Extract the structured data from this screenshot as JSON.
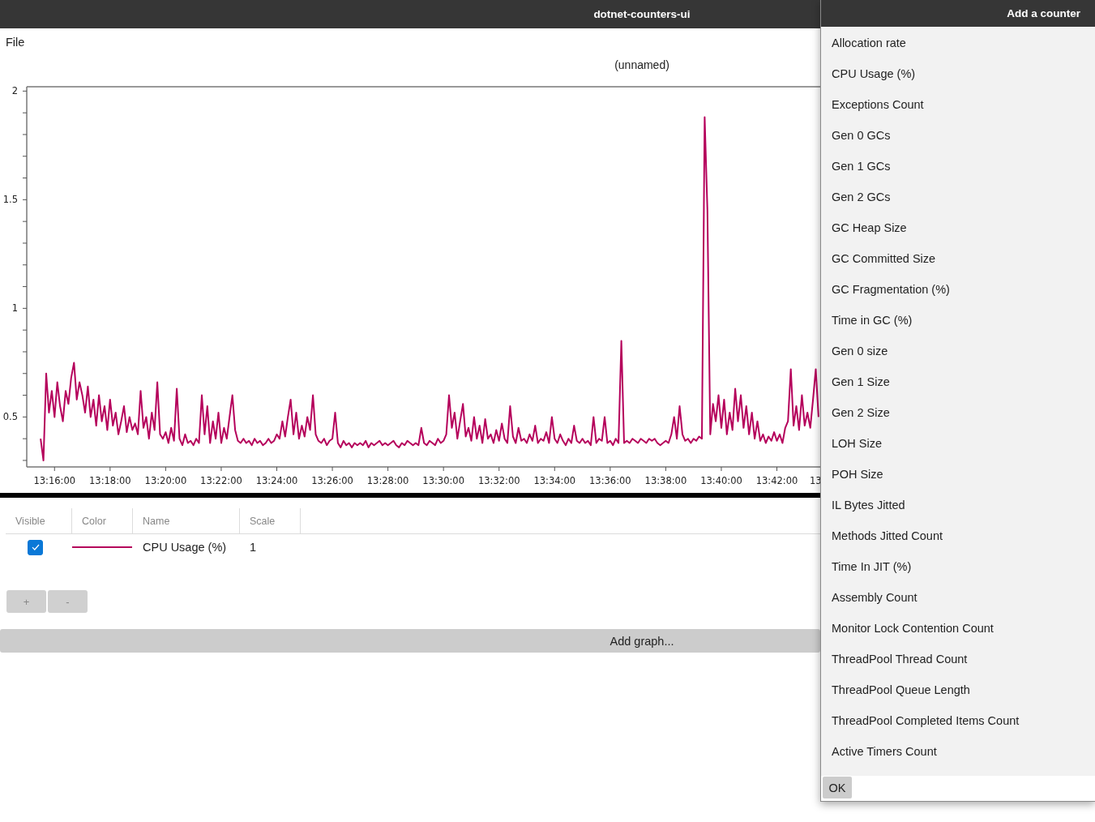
{
  "window": {
    "title": "dotnet-counters-ui"
  },
  "menu": [
    "File"
  ],
  "chart": {
    "chart_data": {
      "type": "line",
      "title": "(unnamed)",
      "ylim": [
        0.27,
        2.02
      ],
      "yticks": [
        0.5,
        1,
        1.5,
        2
      ],
      "categories": [
        null,
        null,
        null,
        null,
        null,
        "13:16:00",
        null,
        null,
        null,
        null,
        null,
        null,
        null,
        null,
        null,
        null,
        null,
        null,
        null,
        null,
        null,
        null,
        null,
        null,
        null,
        "13:18:00",
        null,
        null,
        null,
        null,
        null,
        null,
        null,
        null,
        null,
        null,
        null,
        null,
        null,
        null,
        null,
        null,
        null,
        null,
        null,
        "13:20:00",
        null,
        null,
        null,
        null,
        null,
        null,
        null,
        null,
        null,
        null,
        null,
        null,
        null,
        null,
        null,
        null,
        null,
        null,
        null,
        "13:22:00",
        null,
        null,
        null,
        null,
        null,
        null,
        null,
        null,
        null,
        null,
        null,
        null,
        null,
        null,
        null,
        null,
        null,
        null,
        null,
        "13:24:00",
        null,
        null,
        null,
        null,
        null,
        null,
        null,
        null,
        null,
        null,
        null,
        null,
        null,
        null,
        null,
        null,
        null,
        null,
        null,
        "13:26:00",
        null,
        null,
        null,
        null,
        null,
        null,
        null,
        null,
        null,
        null,
        null,
        null,
        null,
        null,
        null,
        null,
        null,
        null,
        null,
        "13:28:00",
        null,
        null,
        null,
        null,
        null,
        null,
        null,
        null,
        null,
        null,
        null,
        null,
        null,
        null,
        null,
        null,
        null,
        null,
        null,
        "13:30:00",
        null,
        null,
        null,
        null,
        null,
        null,
        null,
        null,
        null,
        null,
        null,
        null,
        null,
        null,
        null,
        null,
        null,
        null,
        null,
        "13:32:00",
        null,
        null,
        null,
        null,
        null,
        null,
        null,
        null,
        null,
        null,
        null,
        null,
        null,
        null,
        null,
        null,
        null,
        null,
        null,
        "13:34:00",
        null,
        null,
        null,
        null,
        null,
        null,
        null,
        null,
        null,
        null,
        null,
        null,
        null,
        null,
        null,
        null,
        null,
        null,
        null,
        "13:36:00",
        null,
        null,
        null,
        null,
        null,
        null,
        null,
        null,
        null,
        null,
        null,
        null,
        null,
        null,
        null,
        null,
        null,
        null,
        null,
        "13:38:00",
        null,
        null,
        null,
        null,
        null,
        null,
        null,
        null,
        null,
        null,
        null,
        null,
        null,
        null,
        null,
        null,
        null,
        null,
        null,
        "13:40:00",
        null,
        null,
        null,
        null,
        null,
        null,
        null,
        null,
        null,
        null,
        null,
        null,
        null,
        null,
        null,
        null,
        null,
        null,
        null,
        "13:42:00",
        null,
        null,
        null,
        null,
        null,
        null,
        null,
        null,
        null,
        null,
        null,
        null,
        null,
        null,
        null
      ],
      "series": [
        {
          "color": "#b5005b",
          "values": [
            0.4,
            0.3,
            0.7,
            0.52,
            0.62,
            0.5,
            0.66,
            0.55,
            0.48,
            0.62,
            0.56,
            0.68,
            0.75,
            0.58,
            0.66,
            0.6,
            0.52,
            0.64,
            0.5,
            0.58,
            0.46,
            0.6,
            0.48,
            0.55,
            0.44,
            0.58,
            0.46,
            0.52,
            0.42,
            0.48,
            0.55,
            0.43,
            0.5,
            0.44,
            0.47,
            0.42,
            0.62,
            0.45,
            0.5,
            0.4,
            0.52,
            0.44,
            0.66,
            0.42,
            0.4,
            0.43,
            0.38,
            0.45,
            0.39,
            0.63,
            0.4,
            0.37,
            0.42,
            0.38,
            0.39,
            0.37,
            0.4,
            0.38,
            0.6,
            0.42,
            0.55,
            0.38,
            0.48,
            0.4,
            0.52,
            0.38,
            0.45,
            0.4,
            0.5,
            0.6,
            0.44,
            0.39,
            0.38,
            0.4,
            0.38,
            0.39,
            0.37,
            0.4,
            0.38,
            0.39,
            0.37,
            0.38,
            0.4,
            0.38,
            0.39,
            0.42,
            0.4,
            0.48,
            0.41,
            0.5,
            0.58,
            0.42,
            0.52,
            0.4,
            0.46,
            0.41,
            0.5,
            0.44,
            0.6,
            0.42,
            0.39,
            0.38,
            0.4,
            0.37,
            0.39,
            0.4,
            0.52,
            0.38,
            0.36,
            0.39,
            0.37,
            0.38,
            0.36,
            0.38,
            0.37,
            0.38,
            0.37,
            0.39,
            0.36,
            0.38,
            0.37,
            0.38,
            0.39,
            0.37,
            0.38,
            0.37,
            0.38,
            0.39,
            0.37,
            0.36,
            0.38,
            0.37,
            0.39,
            0.38,
            0.37,
            0.38,
            0.37,
            0.45,
            0.38,
            0.37,
            0.39,
            0.38,
            0.37,
            0.4,
            0.38,
            0.39,
            0.42,
            0.6,
            0.45,
            0.52,
            0.4,
            0.48,
            0.56,
            0.41,
            0.45,
            0.39,
            0.5,
            0.4,
            0.46,
            0.38,
            0.49,
            0.4,
            0.42,
            0.38,
            0.44,
            0.39,
            0.47,
            0.4,
            0.38,
            0.55,
            0.41,
            0.38,
            0.45,
            0.39,
            0.4,
            0.38,
            0.42,
            0.39,
            0.46,
            0.38,
            0.4,
            0.39,
            0.43,
            0.38,
            0.5,
            0.4,
            0.38,
            0.42,
            0.39,
            0.37,
            0.4,
            0.38,
            0.46,
            0.39,
            0.38,
            0.4,
            0.38,
            0.39,
            0.37,
            0.5,
            0.38,
            0.4,
            0.39,
            0.5,
            0.38,
            0.39,
            0.37,
            0.4,
            0.38,
            0.85,
            0.38,
            0.39,
            0.38,
            0.4,
            0.39,
            0.38,
            0.4,
            0.39,
            0.38,
            0.4,
            0.39,
            0.4,
            0.38,
            0.37,
            0.38,
            0.39,
            0.38,
            0.42,
            0.5,
            0.4,
            0.55,
            0.42,
            0.39,
            0.4,
            0.38,
            0.4,
            0.39,
            0.41,
            0.4,
            1.88,
            1.45,
            0.42,
            0.56,
            0.48,
            0.6,
            0.45,
            0.58,
            0.42,
            0.52,
            0.44,
            0.63,
            0.48,
            0.6,
            0.45,
            0.55,
            0.42,
            0.52,
            0.4,
            0.48,
            0.39,
            0.42,
            0.38,
            0.41,
            0.39,
            0.43,
            0.39,
            0.42,
            0.38,
            0.45,
            0.48,
            0.72,
            0.46,
            0.55,
            0.44,
            0.6,
            0.46,
            0.52,
            0.45,
            0.58,
            0.72,
            0.5
          ]
        }
      ]
    },
    "edge_label": "13"
  },
  "table": {
    "columns": [
      "Visible",
      "Color",
      "Name",
      "Scale"
    ],
    "rows": [
      {
        "visible": true,
        "color": "#b5005b",
        "name": "CPU Usage (%)",
        "scale": "1"
      }
    ]
  },
  "table_buttons": [
    "+",
    "-"
  ],
  "add_graph_button": "Add graph...",
  "dialog": {
    "title": "Add a counter",
    "items": [
      {
        "label": "Allocation rate",
        "selected": false
      },
      {
        "label": "CPU Usage (%)",
        "selected": false
      },
      {
        "label": "Exceptions Count",
        "selected": false
      },
      {
        "label": "Gen 0 GCs",
        "selected": false
      },
      {
        "label": "Gen 1 GCs",
        "selected": false
      },
      {
        "label": "Gen 2 GCs",
        "selected": false
      },
      {
        "label": "GC Heap Size",
        "selected": false
      },
      {
        "label": "GC Committed Size",
        "selected": false
      },
      {
        "label": "GC Fragmentation (%)",
        "selected": false
      },
      {
        "label": "Time in GC (%)",
        "selected": false
      },
      {
        "label": "Gen 0 size",
        "selected": false
      },
      {
        "label": "Gen 1 Size",
        "selected": false
      },
      {
        "label": "Gen 2 Size",
        "selected": false
      },
      {
        "label": "LOH Size",
        "selected": false
      },
      {
        "label": "POH Size",
        "selected": false
      },
      {
        "label": "IL Bytes Jitted",
        "selected": false
      },
      {
        "label": "Methods Jitted Count",
        "selected": false
      },
      {
        "label": "Time In JIT (%)",
        "selected": false
      },
      {
        "label": "Assembly Count",
        "selected": false
      },
      {
        "label": "Monitor Lock Contention Count",
        "selected": false
      },
      {
        "label": "ThreadPool Thread Count",
        "selected": false
      },
      {
        "label": "ThreadPool Queue Length",
        "selected": false
      },
      {
        "label": "ThreadPool Completed Items Count",
        "selected": false
      },
      {
        "label": "Active Timers Count",
        "selected": false
      }
    ],
    "buttons": [
      "OK"
    ]
  }
}
